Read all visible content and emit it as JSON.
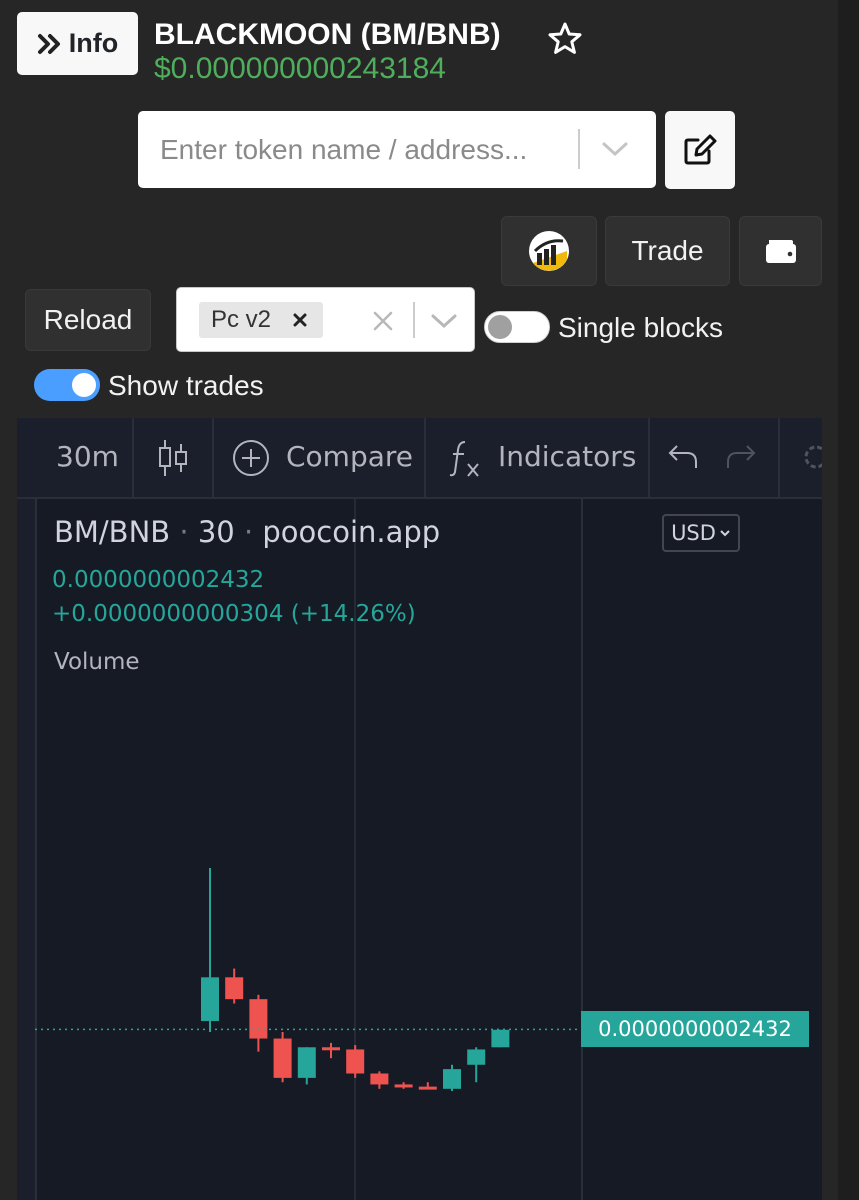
{
  "header": {
    "info_label": "Info",
    "token_title": "BLACKMOON (BM/BNB)",
    "price": "$0.000000000243184"
  },
  "search": {
    "placeholder": "Enter token name / address..."
  },
  "actions": {
    "trade_label": "Trade",
    "reload_label": "Reload"
  },
  "dex_select": {
    "selected_tag": "Pc v2"
  },
  "toggles": {
    "single_blocks_label": "Single blocks",
    "single_blocks_on": false,
    "show_trades_label": "Show trades",
    "show_trades_on": true
  },
  "chart_toolbar": {
    "interval": "30m",
    "compare_label": "Compare",
    "indicators_label": "Indicators"
  },
  "chart_legend": {
    "symbol": "BM/BNB",
    "interval": "30",
    "source": "poocoin.app",
    "last_price": "0.0000000002432",
    "change": "+0.0000000000304 (+14.26%)",
    "volume_label": "Volume",
    "currency": "USD"
  },
  "chart_data": {
    "type": "candlestick",
    "last_price_label": "0.0000000002432",
    "up_color": "#26a69a",
    "down_color": "#ef5350",
    "candles": [
      {
        "open": 2.47e-10,
        "high": 3.17e-10,
        "low": 2.42e-10,
        "close": 2.67e-10
      },
      {
        "open": 2.67e-10,
        "high": 2.71e-10,
        "low": 2.55e-10,
        "close": 2.57e-10
      },
      {
        "open": 2.57e-10,
        "high": 2.59e-10,
        "low": 2.33e-10,
        "close": 2.39e-10
      },
      {
        "open": 2.39e-10,
        "high": 2.42e-10,
        "low": 2.19e-10,
        "close": 2.21e-10
      },
      {
        "open": 2.21e-10,
        "high": 2.35e-10,
        "low": 2.18e-10,
        "close": 2.35e-10
      },
      {
        "open": 2.35e-10,
        "high": 2.37e-10,
        "low": 2.3e-10,
        "close": 2.34e-10
      },
      {
        "open": 2.34e-10,
        "high": 2.36e-10,
        "low": 2.21e-10,
        "close": 2.23e-10
      },
      {
        "open": 2.23e-10,
        "high": 2.24e-10,
        "low": 2.16e-10,
        "close": 2.18e-10
      },
      {
        "open": 2.18e-10,
        "high": 2.19e-10,
        "low": 2.16e-10,
        "close": 2.17e-10
      },
      {
        "open": 2.17e-10,
        "high": 2.19e-10,
        "low": 2.16e-10,
        "close": 2.16e-10
      },
      {
        "open": 2.16e-10,
        "high": 2.27e-10,
        "low": 2.15e-10,
        "close": 2.25e-10
      },
      {
        "open": 2.27e-10,
        "high": 2.35e-10,
        "low": 2.19e-10,
        "close": 2.34e-10
      },
      {
        "open": 2.35e-10,
        "high": 2.43e-10,
        "low": 2.35e-10,
        "close": 2.43e-10
      }
    ]
  }
}
